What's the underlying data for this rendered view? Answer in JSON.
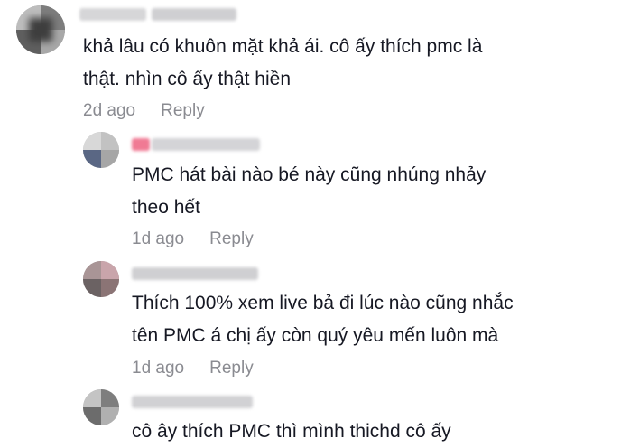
{
  "comments": [
    {
      "lines": [
        "khả lâu có khuôn mặt khả ái. cô ấy thích pmc là",
        "thật. nhìn cô ấy thật hiền"
      ],
      "time": "2d ago",
      "reply_label": "Reply"
    },
    {
      "lines": [
        "PMC hát bài nào bé này cũng nhúng nhảy",
        "theo hết"
      ],
      "time": "1d ago",
      "reply_label": "Reply"
    },
    {
      "lines": [
        "Thích 100% xem live bả đi lúc nào cũng nhắc",
        "tên PMC á chị ấy còn quý yêu mến luôn mà"
      ],
      "time": "1d ago",
      "reply_label": "Reply"
    },
    {
      "lines": [
        "cô ây thích PMC thì mình thichd cô ấy"
      ],
      "time": "",
      "reply_label": ""
    }
  ],
  "colors": {
    "text": "#161823",
    "meta": "#8a8b91",
    "blur_gray": "#c9c9cc",
    "blur_pink": "#f07a94"
  }
}
